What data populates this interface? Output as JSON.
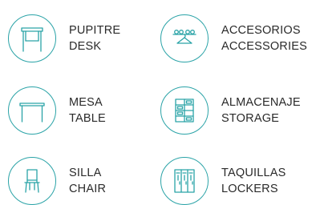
{
  "categories": [
    {
      "es": "PUPITRE",
      "en": "DESK",
      "icon": "desk-icon"
    },
    {
      "es": "ACCESORIOS",
      "en": "ACCESSORIES",
      "icon": "accessories-icon"
    },
    {
      "es": "MESA",
      "en": "TABLE",
      "icon": "table-icon"
    },
    {
      "es": "ALMACENAJE",
      "en": "STORAGE",
      "icon": "storage-icon"
    },
    {
      "es": "SILLA",
      "en": "CHAIR",
      "icon": "chair-icon"
    },
    {
      "es": "TAQUILLAS",
      "en": "LOCKERS",
      "icon": "lockers-icon"
    }
  ],
  "colors": {
    "accent": "#2aa3a7",
    "text": "#2a2a2a"
  }
}
